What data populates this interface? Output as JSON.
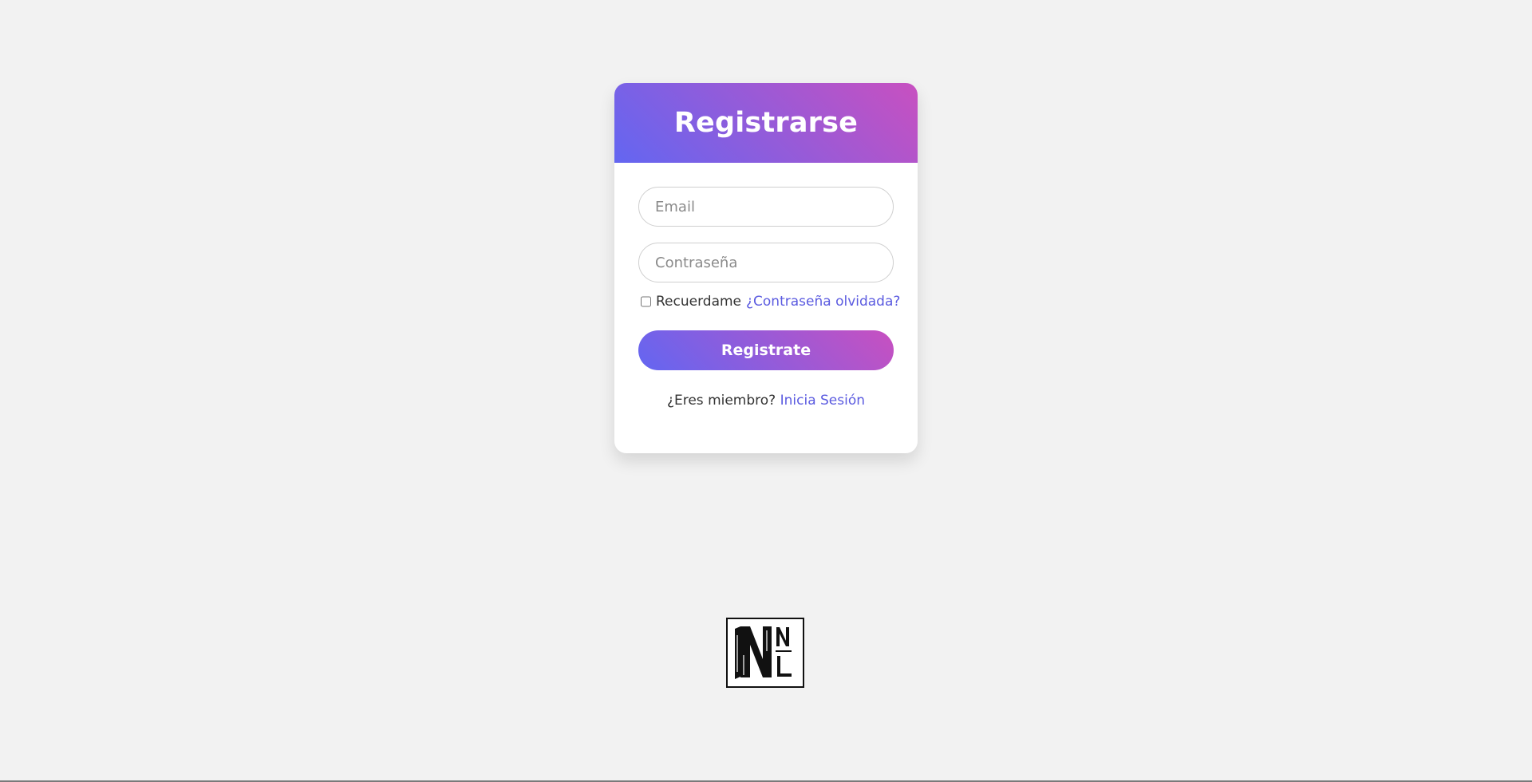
{
  "card": {
    "title": "Registrarse",
    "email_placeholder": "Email",
    "password_placeholder": "Contraseña",
    "remember_label": "Recuerdame",
    "forgot_link": "¿Contraseña olvidada?",
    "submit_label": "Registrate",
    "member_text": "¿Eres miembro?",
    "login_link": "Inicia Sesión"
  },
  "logo": {
    "icon": "nnl-logo-icon",
    "letters": "NNL"
  },
  "colors": {
    "gradient_start": "#6366f1",
    "gradient_end": "#c850c0",
    "link": "#5b5be0",
    "background": "#f2f2f2"
  }
}
